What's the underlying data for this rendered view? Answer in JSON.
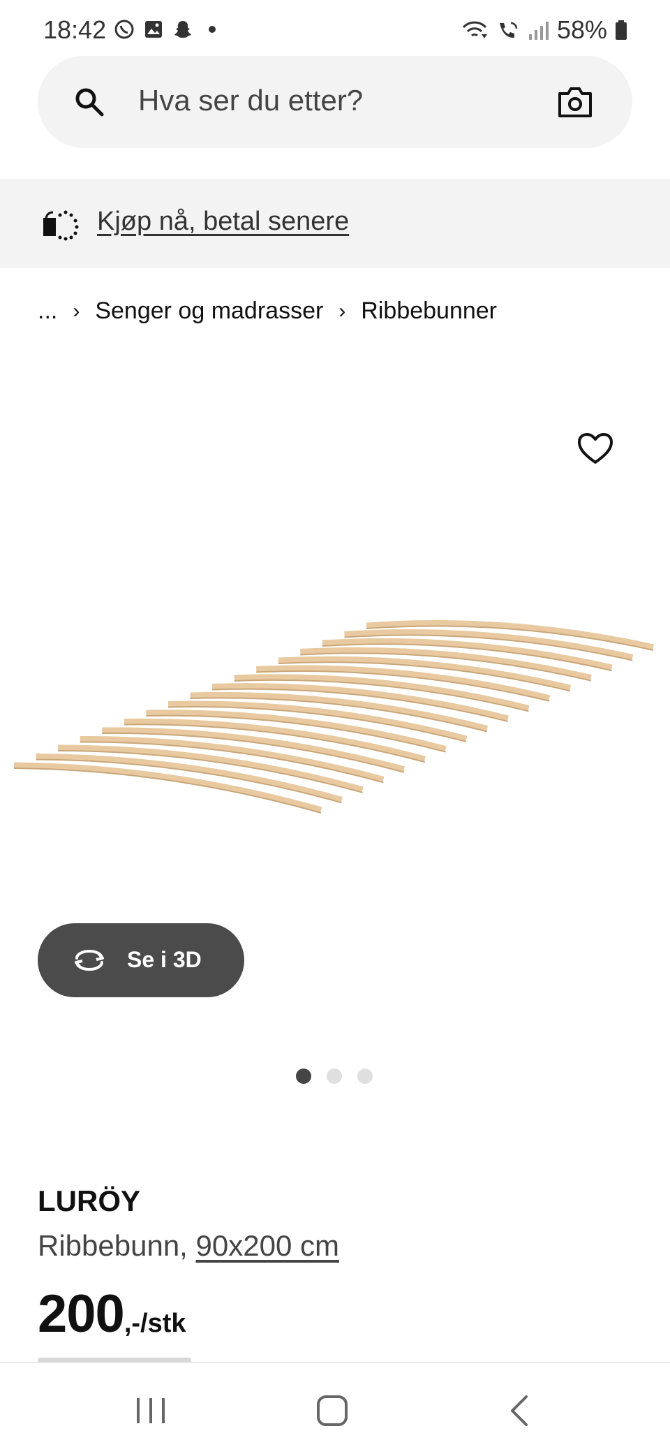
{
  "status": {
    "time": "18:42",
    "battery": "58%",
    "left_icons": [
      "whatsapp-icon",
      "gallery-icon",
      "snapchat-icon",
      "notification-dot-icon"
    ],
    "right_icons": [
      "wifi-icon",
      "wifi-calling-icon",
      "signal-icon",
      "battery-icon"
    ]
  },
  "search": {
    "placeholder": "Hva ser du etter?",
    "icon": "search-icon",
    "camera_icon": "camera-icon"
  },
  "promo": {
    "label": "Kjøp nå, betal senere",
    "icon": "payment-basket-icon"
  },
  "breadcrumb": {
    "ellipsis": "...",
    "items": [
      "Senger og madrasser",
      "Ribbebunner"
    ]
  },
  "product": {
    "view3d_label": "Se i 3D",
    "carousel": {
      "count": 3,
      "active": 0
    },
    "name": "LURÖY",
    "desc_prefix": "Ribbebunn,",
    "size": "90x200 cm",
    "price_int": "200",
    "price_suffix": ",-/stk"
  },
  "navbar": {
    "items": [
      "recent-apps-icon",
      "home-icon",
      "back-icon"
    ]
  },
  "colors": {
    "search_bg": "#f3f3f3",
    "button_dark": "#4b4b4b",
    "text": "#111111",
    "wood": "#e8c9a0"
  }
}
